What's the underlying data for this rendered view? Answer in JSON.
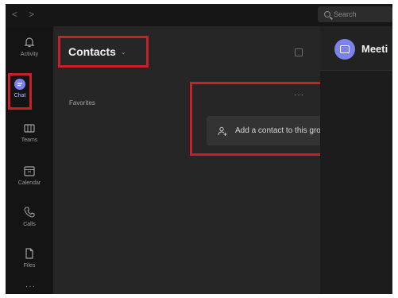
{
  "titlebar": {
    "back_glyph": "<",
    "forward_glyph": ">",
    "search_placeholder": "Search"
  },
  "rail": {
    "items": [
      {
        "label": "Activity",
        "icon": "bell-icon"
      },
      {
        "label": "Chat",
        "icon": "chat-icon",
        "active": true
      },
      {
        "label": "Teams",
        "icon": "teams-icon"
      },
      {
        "label": "Calendar",
        "icon": "calendar-icon"
      },
      {
        "label": "Calls",
        "icon": "phone-icon"
      },
      {
        "label": "Files",
        "icon": "file-icon"
      }
    ],
    "more_label": "···"
  },
  "contacts": {
    "title": "Contacts",
    "chevron": "⌄",
    "group_name": "Favorites",
    "more_dots": "···",
    "add_contact_label": "Add a contact to this group"
  },
  "chat_header": {
    "name": "Meeti"
  },
  "colors": {
    "highlight": "#c8202a",
    "accent": "#7b83eb",
    "active_text": "#b9b8ff"
  }
}
